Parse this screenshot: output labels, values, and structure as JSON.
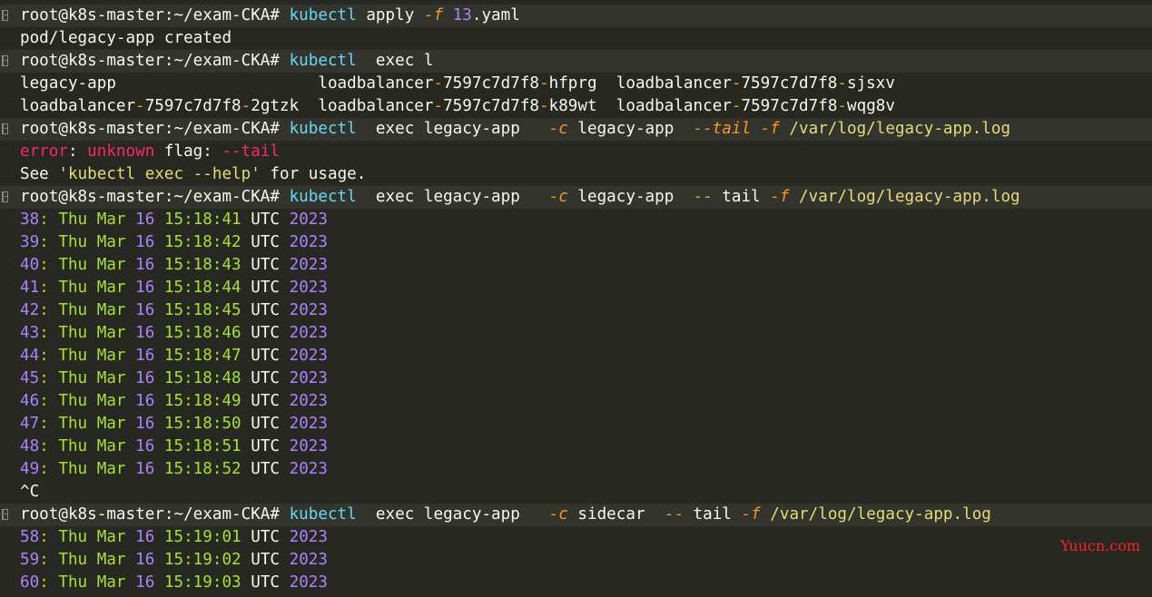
{
  "terminal": {
    "prompt": "root@k8s-master:~/exam-CKA#",
    "lines": [
      {
        "kind": "cmd",
        "segs": [
          {
            "t": "root@k8s-master:~/exam-CKA# ",
            "c": "c-white"
          },
          {
            "t": "kubectl",
            "c": "c-cyan"
          },
          {
            "t": " apply ",
            "c": "c-white"
          },
          {
            "t": "-f",
            "c": "c-orange-i"
          },
          {
            "t": " ",
            "c": "c-white"
          },
          {
            "t": "13",
            "c": "c-purple"
          },
          {
            "t": ".yaml",
            "c": "c-white"
          }
        ]
      },
      {
        "kind": "out",
        "segs": [
          {
            "t": "pod/legacy-app created",
            "c": "c-white"
          }
        ]
      },
      {
        "kind": "cmd",
        "segs": [
          {
            "t": "root@k8s-master:~/exam-CKA# ",
            "c": "c-white"
          },
          {
            "t": "kubectl",
            "c": "c-cyan"
          },
          {
            "t": "  exec l",
            "c": "c-white"
          }
        ]
      },
      {
        "kind": "out",
        "segs": [
          {
            "t": "legacy-app                     loadbalancer",
            "c": "c-white"
          },
          {
            "t": "-",
            "c": "c-orange"
          },
          {
            "t": "7597c7d7f8",
            "c": "c-white"
          },
          {
            "t": "-",
            "c": "c-orange"
          },
          {
            "t": "hfprg  loadbalancer",
            "c": "c-white"
          },
          {
            "t": "-",
            "c": "c-orange"
          },
          {
            "t": "7597c7d7f8",
            "c": "c-white"
          },
          {
            "t": "-",
            "c": "c-orange"
          },
          {
            "t": "sjsxv",
            "c": "c-white"
          }
        ]
      },
      {
        "kind": "out",
        "segs": [
          {
            "t": "loadbalancer",
            "c": "c-white"
          },
          {
            "t": "-",
            "c": "c-orange"
          },
          {
            "t": "7597c7d7f8",
            "c": "c-white"
          },
          {
            "t": "-",
            "c": "c-orange"
          },
          {
            "t": "2gtzk  loadbalancer",
            "c": "c-white"
          },
          {
            "t": "-",
            "c": "c-orange"
          },
          {
            "t": "7597c7d7f8",
            "c": "c-white"
          },
          {
            "t": "-",
            "c": "c-orange"
          },
          {
            "t": "k89wt  loadbalancer",
            "c": "c-white"
          },
          {
            "t": "-",
            "c": "c-orange"
          },
          {
            "t": "7597c7d7f8",
            "c": "c-white"
          },
          {
            "t": "-",
            "c": "c-orange"
          },
          {
            "t": "wqg8v",
            "c": "c-white"
          }
        ]
      },
      {
        "kind": "cmd",
        "segs": [
          {
            "t": "root@k8s-master:~/exam-CKA# ",
            "c": "c-white"
          },
          {
            "t": "kubectl",
            "c": "c-cyan"
          },
          {
            "t": "  exec legacy-app   ",
            "c": "c-white"
          },
          {
            "t": "-c",
            "c": "c-orange-i"
          },
          {
            "t": " legacy-app  ",
            "c": "c-white"
          },
          {
            "t": "--tail",
            "c": "c-orange-i"
          },
          {
            "t": " ",
            "c": "c-white"
          },
          {
            "t": "-f",
            "c": "c-orange-i"
          },
          {
            "t": " /var/log/legacy-app.log",
            "c": "c-yellow"
          }
        ]
      },
      {
        "kind": "out",
        "segs": [
          {
            "t": "error",
            "c": "c-red"
          },
          {
            "t": ": ",
            "c": "c-white"
          },
          {
            "t": "unknown",
            "c": "c-red"
          },
          {
            "t": " flag: ",
            "c": "c-white"
          },
          {
            "t": "--tail",
            "c": "c-red"
          }
        ]
      },
      {
        "kind": "out",
        "segs": [
          {
            "t": "See ",
            "c": "c-white"
          },
          {
            "t": "'kubectl exec --help'",
            "c": "c-yellow"
          },
          {
            "t": " for usage.",
            "c": "c-white"
          }
        ]
      },
      {
        "kind": "cmd",
        "segs": [
          {
            "t": "root@k8s-master:~/exam-CKA# ",
            "c": "c-white"
          },
          {
            "t": "kubectl",
            "c": "c-cyan"
          },
          {
            "t": "  exec legacy-app   ",
            "c": "c-white"
          },
          {
            "t": "-c",
            "c": "c-orange-i"
          },
          {
            "t": " legacy-app  ",
            "c": "c-white"
          },
          {
            "t": "--",
            "c": "c-orange"
          },
          {
            "t": " tail ",
            "c": "c-white"
          },
          {
            "t": "-f",
            "c": "c-orange-i"
          },
          {
            "t": " /var/log/legacy-app.log",
            "c": "c-yellow"
          }
        ]
      },
      {
        "kind": "log",
        "segs": [
          {
            "t": "38",
            "c": "c-purple"
          },
          {
            "t": ": Thu Mar ",
            "c": "c-green"
          },
          {
            "t": "16",
            "c": "c-purple"
          },
          {
            "t": " 15:18:41 ",
            "c": "c-green"
          },
          {
            "t": "UTC ",
            "c": "c-white"
          },
          {
            "t": "2023",
            "c": "c-purple"
          }
        ]
      },
      {
        "kind": "log",
        "segs": [
          {
            "t": "39",
            "c": "c-purple"
          },
          {
            "t": ": Thu Mar ",
            "c": "c-green"
          },
          {
            "t": "16",
            "c": "c-purple"
          },
          {
            "t": " 15:18:42 ",
            "c": "c-green"
          },
          {
            "t": "UTC ",
            "c": "c-white"
          },
          {
            "t": "2023",
            "c": "c-purple"
          }
        ]
      },
      {
        "kind": "log",
        "segs": [
          {
            "t": "40",
            "c": "c-purple"
          },
          {
            "t": ": Thu Mar ",
            "c": "c-green"
          },
          {
            "t": "16",
            "c": "c-purple"
          },
          {
            "t": " 15:18:43 ",
            "c": "c-green"
          },
          {
            "t": "UTC ",
            "c": "c-white"
          },
          {
            "t": "2023",
            "c": "c-purple"
          }
        ]
      },
      {
        "kind": "log",
        "segs": [
          {
            "t": "41",
            "c": "c-purple"
          },
          {
            "t": ": Thu Mar ",
            "c": "c-green"
          },
          {
            "t": "16",
            "c": "c-purple"
          },
          {
            "t": " 15:18:44 ",
            "c": "c-green"
          },
          {
            "t": "UTC ",
            "c": "c-white"
          },
          {
            "t": "2023",
            "c": "c-purple"
          }
        ]
      },
      {
        "kind": "log",
        "segs": [
          {
            "t": "42",
            "c": "c-purple"
          },
          {
            "t": ": Thu Mar ",
            "c": "c-green"
          },
          {
            "t": "16",
            "c": "c-purple"
          },
          {
            "t": " 15:18:45 ",
            "c": "c-green"
          },
          {
            "t": "UTC ",
            "c": "c-white"
          },
          {
            "t": "2023",
            "c": "c-purple"
          }
        ]
      },
      {
        "kind": "log",
        "segs": [
          {
            "t": "43",
            "c": "c-purple"
          },
          {
            "t": ": Thu Mar ",
            "c": "c-green"
          },
          {
            "t": "16",
            "c": "c-purple"
          },
          {
            "t": " 15:18:46 ",
            "c": "c-green"
          },
          {
            "t": "UTC ",
            "c": "c-white"
          },
          {
            "t": "2023",
            "c": "c-purple"
          }
        ]
      },
      {
        "kind": "log",
        "segs": [
          {
            "t": "44",
            "c": "c-purple"
          },
          {
            "t": ": Thu Mar ",
            "c": "c-green"
          },
          {
            "t": "16",
            "c": "c-purple"
          },
          {
            "t": " 15:18:47 ",
            "c": "c-green"
          },
          {
            "t": "UTC ",
            "c": "c-white"
          },
          {
            "t": "2023",
            "c": "c-purple"
          }
        ]
      },
      {
        "kind": "log",
        "segs": [
          {
            "t": "45",
            "c": "c-purple"
          },
          {
            "t": ": Thu Mar ",
            "c": "c-green"
          },
          {
            "t": "16",
            "c": "c-purple"
          },
          {
            "t": " 15:18:48 ",
            "c": "c-green"
          },
          {
            "t": "UTC ",
            "c": "c-white"
          },
          {
            "t": "2023",
            "c": "c-purple"
          }
        ]
      },
      {
        "kind": "log",
        "segs": [
          {
            "t": "46",
            "c": "c-purple"
          },
          {
            "t": ": Thu Mar ",
            "c": "c-green"
          },
          {
            "t": "16",
            "c": "c-purple"
          },
          {
            "t": " 15:18:49 ",
            "c": "c-green"
          },
          {
            "t": "UTC ",
            "c": "c-white"
          },
          {
            "t": "2023",
            "c": "c-purple"
          }
        ]
      },
      {
        "kind": "log",
        "segs": [
          {
            "t": "47",
            "c": "c-purple"
          },
          {
            "t": ": Thu Mar ",
            "c": "c-green"
          },
          {
            "t": "16",
            "c": "c-purple"
          },
          {
            "t": " 15:18:50 ",
            "c": "c-green"
          },
          {
            "t": "UTC ",
            "c": "c-white"
          },
          {
            "t": "2023",
            "c": "c-purple"
          }
        ]
      },
      {
        "kind": "log",
        "segs": [
          {
            "t": "48",
            "c": "c-purple"
          },
          {
            "t": ": Thu Mar ",
            "c": "c-green"
          },
          {
            "t": "16",
            "c": "c-purple"
          },
          {
            "t": " 15:18:51 ",
            "c": "c-green"
          },
          {
            "t": "UTC ",
            "c": "c-white"
          },
          {
            "t": "2023",
            "c": "c-purple"
          }
        ]
      },
      {
        "kind": "log",
        "segs": [
          {
            "t": "49",
            "c": "c-purple"
          },
          {
            "t": ": Thu Mar ",
            "c": "c-green"
          },
          {
            "t": "16",
            "c": "c-purple"
          },
          {
            "t": " 15:18:52 ",
            "c": "c-green"
          },
          {
            "t": "UTC ",
            "c": "c-white"
          },
          {
            "t": "2023",
            "c": "c-purple"
          }
        ]
      },
      {
        "kind": "out",
        "segs": [
          {
            "t": "^C",
            "c": "c-white"
          }
        ]
      },
      {
        "kind": "cmd",
        "segs": [
          {
            "t": "root@k8s-master:~/exam-CKA# ",
            "c": "c-white"
          },
          {
            "t": "kubectl",
            "c": "c-cyan"
          },
          {
            "t": "  exec legacy-app   ",
            "c": "c-white"
          },
          {
            "t": "-c",
            "c": "c-orange-i"
          },
          {
            "t": " sidecar  ",
            "c": "c-white"
          },
          {
            "t": "--",
            "c": "c-orange"
          },
          {
            "t": " tail ",
            "c": "c-white"
          },
          {
            "t": "-f",
            "c": "c-orange-i"
          },
          {
            "t": " /var/log/legacy-app.log",
            "c": "c-yellow"
          }
        ]
      },
      {
        "kind": "log",
        "segs": [
          {
            "t": "58",
            "c": "c-purple"
          },
          {
            "t": ": Thu Mar ",
            "c": "c-green"
          },
          {
            "t": "16",
            "c": "c-purple"
          },
          {
            "t": " 15:19:01 ",
            "c": "c-green"
          },
          {
            "t": "UTC ",
            "c": "c-white"
          },
          {
            "t": "2023",
            "c": "c-purple"
          }
        ]
      },
      {
        "kind": "log",
        "segs": [
          {
            "t": "59",
            "c": "c-purple"
          },
          {
            "t": ": Thu Mar ",
            "c": "c-green"
          },
          {
            "t": "16",
            "c": "c-purple"
          },
          {
            "t": " 15:19:02 ",
            "c": "c-green"
          },
          {
            "t": "UTC ",
            "c": "c-white"
          },
          {
            "t": "2023",
            "c": "c-purple"
          }
        ]
      },
      {
        "kind": "log",
        "segs": [
          {
            "t": "60",
            "c": "c-purple"
          },
          {
            "t": ": Thu Mar ",
            "c": "c-green"
          },
          {
            "t": "16",
            "c": "c-purple"
          },
          {
            "t": " 15:19:03 ",
            "c": "c-green"
          },
          {
            "t": "UTC ",
            "c": "c-white"
          },
          {
            "t": "2023",
            "c": "c-purple"
          }
        ]
      }
    ]
  },
  "watermark": "Yuucn.com",
  "colors": {
    "background": "#272822",
    "command_row": "#33342d",
    "cyan": "#66d9ef",
    "orange": "#fd971f",
    "purple": "#ae81ff",
    "yellow": "#e6db74",
    "green": "#a6e22e",
    "red": "#f92672",
    "watermark": "#ff2020"
  }
}
